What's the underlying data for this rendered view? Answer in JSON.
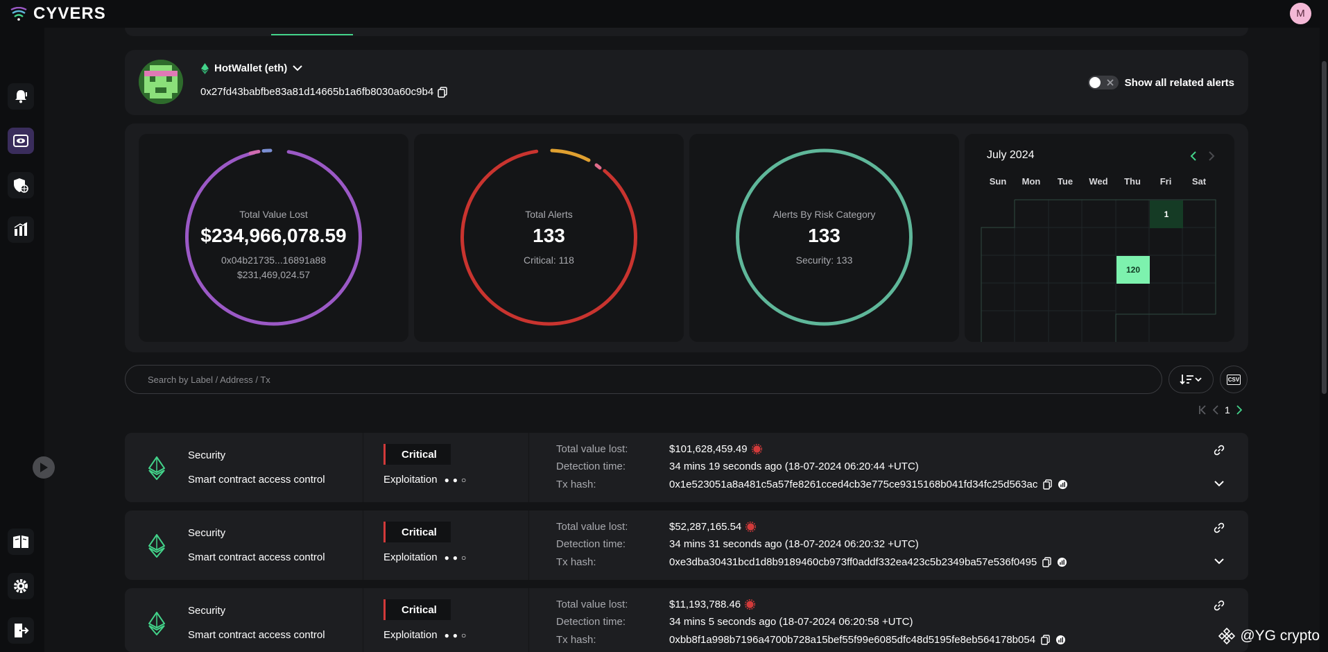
{
  "brand": {
    "name": "CYVERS"
  },
  "user": {
    "initial": "M"
  },
  "wallet": {
    "label": "HotWallet (eth)",
    "address": "0x27fd43babfbe83a81d14665b1a6fb8030a60c9b4",
    "toggle_label": "Show all related alerts"
  },
  "stats": {
    "value_lost": {
      "title": "Total Value Lost",
      "amount": "$234,966,078.59",
      "top_address": "0x04b21735...16891a88",
      "top_amount": "$231,469,024.57"
    },
    "alerts": {
      "title": "Total Alerts",
      "count": "133",
      "sub": "Critical: 118"
    },
    "risk": {
      "title": "Alerts By Risk Category",
      "count": "133",
      "sub": "Security: 133"
    }
  },
  "calendar": {
    "month": "July 2024",
    "days": [
      "Sun",
      "Mon",
      "Tue",
      "Wed",
      "Thu",
      "Fri",
      "Sat"
    ],
    "marks": [
      {
        "label": "1",
        "level": 0.1
      },
      {
        "label": "120",
        "level": 1.0
      }
    ]
  },
  "search": {
    "placeholder": "Search by Label / Address / Tx"
  },
  "pagination": {
    "page": "1"
  },
  "csv": {
    "label": "CSV"
  },
  "alerts": [
    {
      "category": "Security",
      "type": "Smart contract access control",
      "severity": "Critical",
      "stage": "Exploitation",
      "value_label": "Total value lost:",
      "value": "$101,628,459.49",
      "time_label": "Detection time:",
      "time": "34 mins 19 seconds ago (18-07-2024 06:20:44 +UTC)",
      "tx_label": "Tx hash:",
      "tx": "0x1e523051a8a481c5a57fe8261cced4cb3e775ce9315168b041fd34fc25d563ac"
    },
    {
      "category": "Security",
      "type": "Smart contract access control",
      "severity": "Critical",
      "stage": "Exploitation",
      "value_label": "Total value lost:",
      "value": "$52,287,165.54",
      "time_label": "Detection time:",
      "time": "34 mins 31 seconds ago (18-07-2024 06:20:32 +UTC)",
      "tx_label": "Tx hash:",
      "tx": "0xe3dba30431bcd1d8b9189460cb973ff0addf332ea423c5b2349ba57e536f0495"
    },
    {
      "category": "Security",
      "type": "Smart contract access control",
      "severity": "Critical",
      "stage": "Exploitation",
      "value_label": "Total value lost:",
      "value": "$11,193,788.46",
      "time_label": "Detection time:",
      "time": "34 mins 5 seconds ago (18-07-2024 06:20:58 +UTC)",
      "tx_label": "Tx hash:",
      "tx": "0xbb8f1a998b7196a4700b728a15bef55f99e6085dfc48d5195fe8eb564178b054"
    }
  ],
  "watermark": {
    "text": "@YG crypto"
  },
  "colors": {
    "accent": "#43d38a",
    "ring_value": "#9b59c6",
    "ring_alerts": "#c9342f",
    "ring_risk": "#5fb79a",
    "critical": "#d13a3a"
  }
}
